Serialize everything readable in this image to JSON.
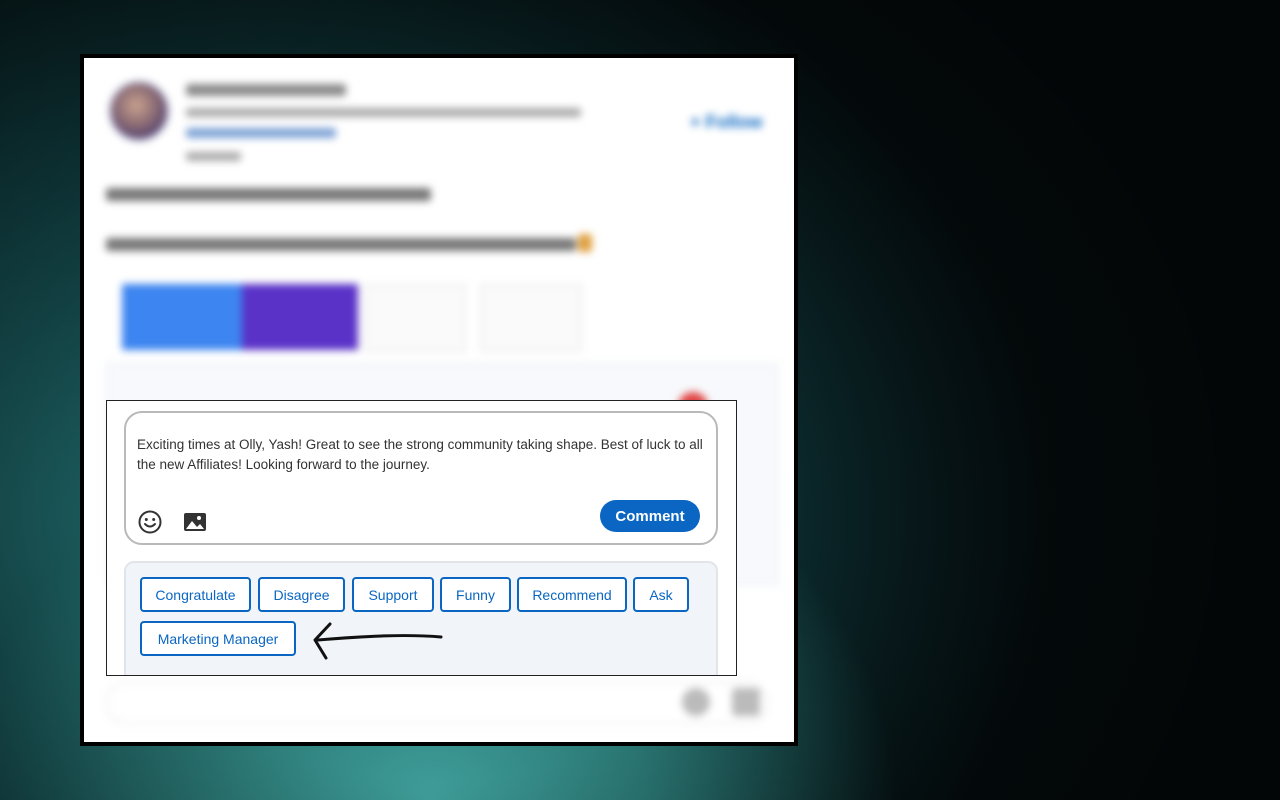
{
  "comment_box": {
    "text": "Exciting times at Olly, Yash! Great to see the strong community taking shape. Best of luck to all the new Affiliates! Looking forward to the journey.",
    "emoji_icon": "smiley-icon",
    "image_icon": "image-icon",
    "comment_label": "Comment"
  },
  "suggestions": {
    "chips": [
      "Congratulate",
      "Disagree",
      "Support",
      "Funny",
      "Recommend",
      "Ask",
      "Marketing Manager"
    ]
  },
  "colors": {
    "accent": "#0a66c2",
    "chip_panel": "#f1f4f8",
    "frame": "#000000"
  }
}
